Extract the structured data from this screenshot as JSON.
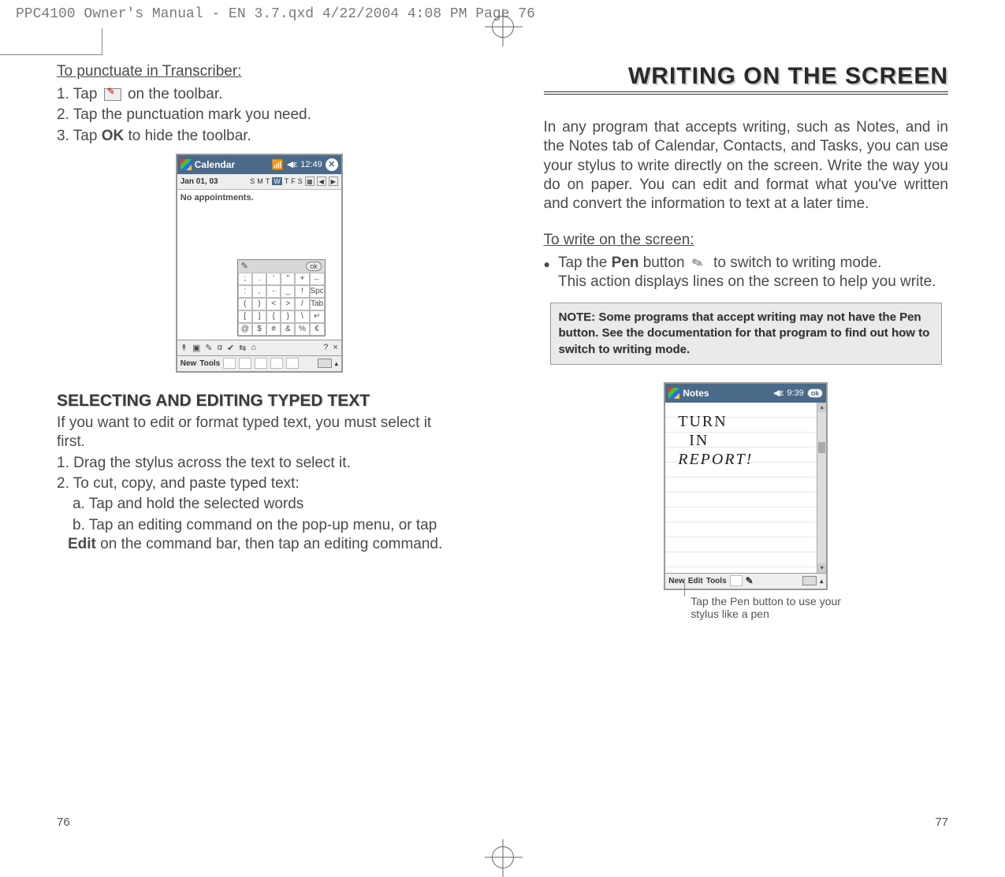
{
  "print_header": "PPC4100 Owner's Manual - EN 3.7.qxd  4/22/2004  4:08 PM  Page 76",
  "left": {
    "punctuate_heading": "To punctuate in Transcriber:",
    "step1_a": "1. Tap ",
    "step1_b": " on the toolbar.",
    "step2": "2. Tap the punctuation mark you need.",
    "step3_a": "3. Tap ",
    "step3_ok": "OK",
    "step3_b": " to hide the toolbar.",
    "fig1": {
      "app": "Calendar",
      "time": "12:49",
      "date": "Jan 01, 03",
      "days": [
        "S",
        "M",
        "T",
        "W",
        "T",
        "F",
        "S"
      ],
      "no_appt": "No appointments.",
      "ok": "ok",
      "grid": [
        ";",
        ".",
        "'",
        "\"",
        "+",
        "←",
        ":",
        ",",
        "-",
        "_",
        "!",
        "Spc",
        "(",
        ")",
        "<",
        ">",
        "/",
        "Tab",
        "[",
        "]",
        "{",
        "}",
        "\\",
        "↵",
        "@",
        "$",
        "#",
        "&",
        "%",
        "€"
      ],
      "toolbar2": [
        "New",
        "Tools"
      ],
      "tool_icons": [
        "↟",
        "▣",
        "✎",
        "α",
        "✔",
        "⇆",
        "⌂",
        "?",
        "×"
      ]
    },
    "section_heading": "SELECTING AND EDITING TYPED TEXT",
    "sel_intro": "If you want to edit or format typed text, you must select it first.",
    "sel_1": "1. Drag the stylus across the text to select it.",
    "sel_2": "2. To cut, copy, and paste typed text:",
    "sel_2a": "a. Tap and hold the selected words",
    "sel_2b_a": "b. Tap an editing command on the pop-up menu, or tap ",
    "sel_2b_edit": "Edit",
    "sel_2b_b": " on the command bar, then tap an editing command.",
    "page_num": "76"
  },
  "right": {
    "title": "WRITING ON THE SCREEN",
    "intro": "In any program that accepts writing, such as Notes, and in the Notes tab of Calendar, Contacts, and Tasks, you can use your stylus to write directly on the screen. Write the way you do on paper. You can edit and format what you've written and convert the information to text at a later time.",
    "write_heading": "To write on the screen:",
    "bullet_a": "Tap the ",
    "bullet_pen": "Pen",
    "bullet_b": " button ",
    "bullet_c": " to switch to writing mode.",
    "bullet_line2": "This action displays lines on the screen to help you write.",
    "note": "NOTE:  Some programs that accept writing may not have the Pen button. See the documentation for that program to find out how  to switch to writing mode.",
    "fig2": {
      "app": "Notes",
      "time": "9:39",
      "ok": "ok",
      "hand1": "TURN",
      "hand2": "IN",
      "hand3": "REPORT!",
      "toolbar": [
        "New",
        "Edit",
        "Tools"
      ]
    },
    "callout": "Tap the Pen button to use your stylus like a pen",
    "page_num": "77"
  }
}
